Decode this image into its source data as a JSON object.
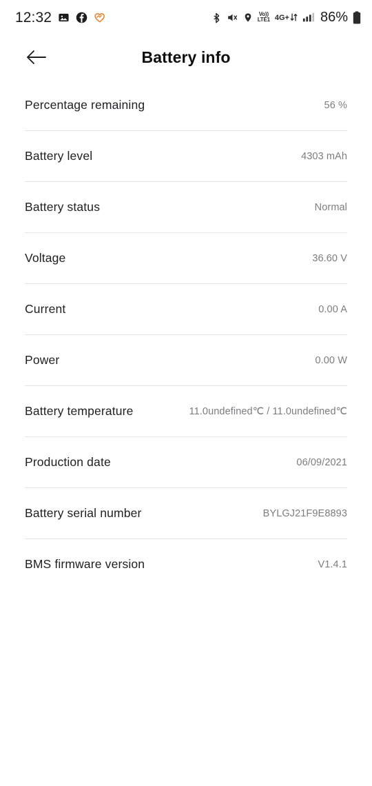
{
  "statusbar": {
    "time": "12:32",
    "left_icons": [
      {
        "name": "gallery-icon",
        "label": "gallery"
      },
      {
        "name": "facebook-icon",
        "label": "facebook"
      },
      {
        "name": "heart-icon",
        "label": "health",
        "color": "#e8883a"
      }
    ],
    "right_icons": [
      {
        "name": "bluetooth-icon",
        "label": "bluetooth"
      },
      {
        "name": "mute-icon",
        "label": "sound off"
      },
      {
        "name": "location-icon",
        "label": "location"
      }
    ],
    "volte": {
      "top": "Vo))",
      "bottom": "LTE1"
    },
    "network": "4G+",
    "battery_percent": "86%"
  },
  "appbar": {
    "back_label": "Back",
    "title": "Battery info"
  },
  "rows": [
    {
      "label": "Percentage remaining",
      "value": "56 %"
    },
    {
      "label": "Battery level",
      "value": "4303 mAh"
    },
    {
      "label": "Battery status",
      "value": "Normal"
    },
    {
      "label": "Voltage",
      "value": "36.60 V"
    },
    {
      "label": "Current",
      "value": "0.00 A"
    },
    {
      "label": "Power",
      "value": "0.00 W"
    },
    {
      "label": "Battery temperature",
      "value": "11.0undefined℃ / 11.0undefined℃"
    },
    {
      "label": "Production date",
      "value": "06/09/2021"
    },
    {
      "label": "Battery serial number",
      "value": "BYLGJ21F9E8893"
    },
    {
      "label": "BMS firmware version",
      "value": "V1.4.1"
    }
  ],
  "colors": {
    "background": "#ffffff",
    "label": "#202124",
    "value": "#7b7d80",
    "divider": "#e4e4e6",
    "accent": "#e8883a"
  }
}
